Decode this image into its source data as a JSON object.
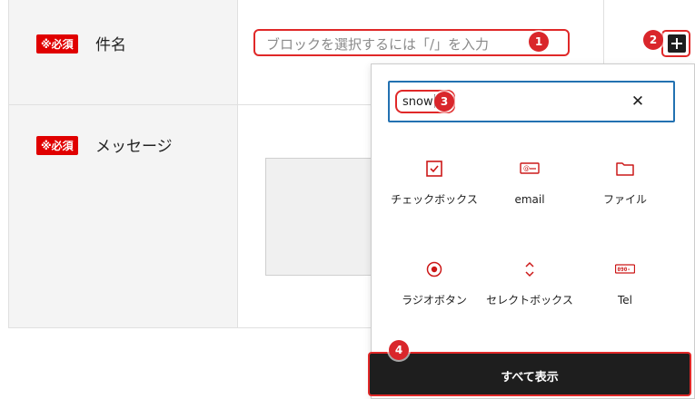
{
  "form": {
    "rows": [
      {
        "badge": "※必須",
        "label": "件名",
        "placeholder": "ブロックを選択するには「/」を入力"
      },
      {
        "badge": "※必須",
        "label": "メッセージ"
      }
    ]
  },
  "inserter": {
    "search_value": "snow",
    "clear_icon": "close-icon",
    "blocks": [
      {
        "label": "チェックボックス",
        "icon": "checkbox-icon"
      },
      {
        "label": "email",
        "icon": "email-icon"
      },
      {
        "label": "ファイル",
        "icon": "folder-icon"
      },
      {
        "label": "ラジオボタン",
        "icon": "radio-icon"
      },
      {
        "label": "セレクトボックス",
        "icon": "select-icon"
      },
      {
        "label": "Tel",
        "icon": "tel-icon"
      }
    ],
    "show_all_label": "すべて表示"
  },
  "markers": [
    "1",
    "2",
    "3",
    "4"
  ],
  "colors": {
    "required": "#e00000",
    "highlight": "#e02828",
    "marker": "#d9262b",
    "focus": "#2271b1",
    "icon_accent": "#cc1818",
    "button_dark": "#1e1e1e"
  }
}
